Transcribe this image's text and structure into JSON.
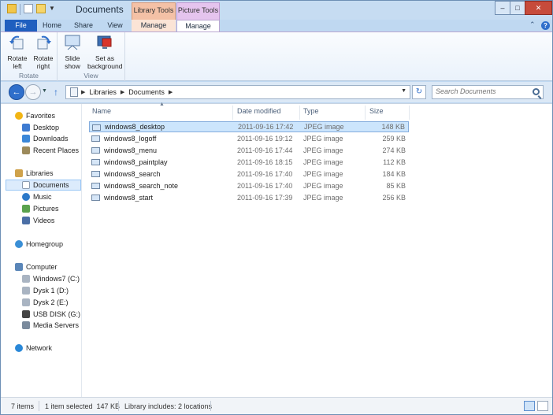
{
  "window": {
    "title": "Documents",
    "context_tabs": {
      "library": "Library Tools",
      "picture": "Picture Tools"
    },
    "controls": {
      "minimize": "–",
      "maximize": "□",
      "close": "✕"
    }
  },
  "ribbon": {
    "tabs": {
      "file": "File",
      "home": "Home",
      "share": "Share",
      "view": "View",
      "manage_library": "Manage",
      "manage_picture": "Manage"
    },
    "minimize_glyph": "⌃",
    "help_glyph": "?",
    "groups": {
      "rotate": {
        "label": "Rotate",
        "rotate_left": [
          "Rotate",
          "left"
        ],
        "rotate_right": [
          "Rotate",
          "right"
        ]
      },
      "view": {
        "label": "View",
        "slide_show": [
          "Slide",
          "show"
        ],
        "set_background": [
          "Set as",
          "background"
        ]
      }
    }
  },
  "navigation": {
    "back_glyph": "←",
    "forward_glyph": "→",
    "recent_glyph": "▼",
    "up_glyph": "↑",
    "breadcrumb": [
      "Libraries",
      "Documents"
    ],
    "refresh_glyph": "↻",
    "search_placeholder": "Search Documents"
  },
  "nav_pane": {
    "favorites": {
      "label": "Favorites",
      "items": [
        "Desktop",
        "Downloads",
        "Recent Places"
      ]
    },
    "libraries": {
      "label": "Libraries",
      "items": [
        "Documents",
        "Music",
        "Pictures",
        "Videos"
      ],
      "selected": "Documents"
    },
    "homegroup": {
      "label": "Homegroup"
    },
    "computer": {
      "label": "Computer",
      "items": [
        "Windows7 (C:)",
        "Dysk 1 (D:)",
        "Dysk 2 (E:)",
        "USB DISK (G:)",
        "Media Servers"
      ]
    },
    "network": {
      "label": "Network"
    }
  },
  "file_list": {
    "columns": {
      "name": "Name",
      "date": "Date modified",
      "type": "Type",
      "size": "Size"
    },
    "sort_glyph": "▲",
    "rows": [
      {
        "name": "windows8_desktop",
        "date": "2011-09-16 17:42",
        "type": "JPEG image",
        "size": "148 KB",
        "selected": true
      },
      {
        "name": "windows8_logoff",
        "date": "2011-09-16 19:12",
        "type": "JPEG image",
        "size": "259 KB"
      },
      {
        "name": "windows8_menu",
        "date": "2011-09-16 17:44",
        "type": "JPEG image",
        "size": "274 KB"
      },
      {
        "name": "windows8_paintplay",
        "date": "2011-09-16 18:15",
        "type": "JPEG image",
        "size": "112 KB"
      },
      {
        "name": "windows8_search",
        "date": "2011-09-16 17:40",
        "type": "JPEG image",
        "size": "184 KB"
      },
      {
        "name": "windows8_search_note",
        "date": "2011-09-16 17:40",
        "type": "JPEG image",
        "size": "85 KB"
      },
      {
        "name": "windows8_start",
        "date": "2011-09-16 17:39",
        "type": "JPEG image",
        "size": "256 KB"
      }
    ]
  },
  "status_bar": {
    "items_count": "7 items",
    "selection": "1 item selected  147 KB",
    "library_info": "Library includes: 2 locations"
  },
  "colors": {
    "accent": "#2f6fcb",
    "file_tab": "#1f5fbf",
    "library_tools": "#f4c1a6",
    "picture_tools": "#e5c4ee",
    "selection": "#cce5fc"
  }
}
